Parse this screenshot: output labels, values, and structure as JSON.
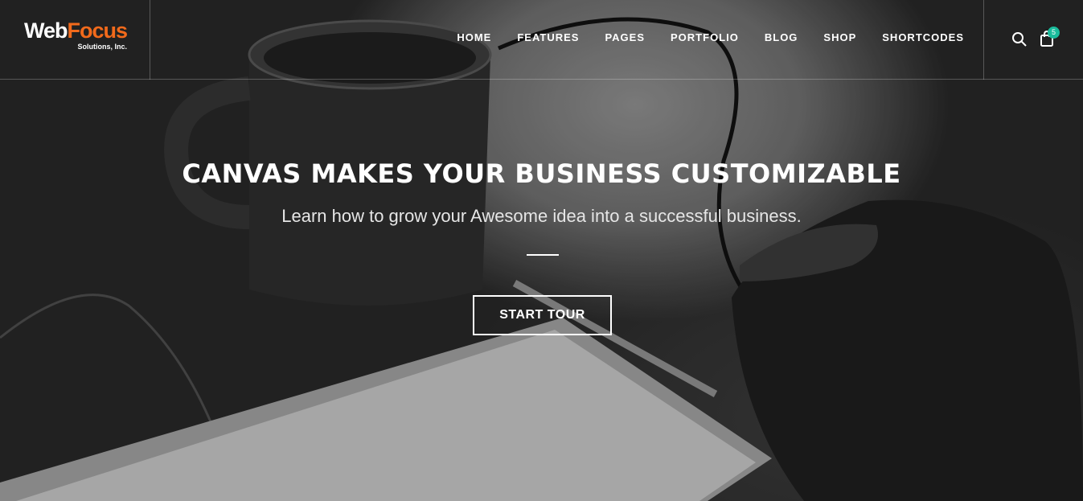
{
  "logo": {
    "word1": "Web",
    "word2": "Focus",
    "tagline": "Solutions, Inc."
  },
  "nav": [
    {
      "label": "HOME"
    },
    {
      "label": "FEATURES"
    },
    {
      "label": "PAGES"
    },
    {
      "label": "PORTFOLIO"
    },
    {
      "label": "BLOG"
    },
    {
      "label": "SHOP"
    },
    {
      "label": "SHORTCODES"
    }
  ],
  "header_icons": {
    "search": "search-icon",
    "cart": "shopping-bag-icon",
    "cart_count": "5"
  },
  "hero": {
    "title": "CANVAS MAKES YOUR BUSINESS CUSTOMIZABLE",
    "subtitle": "Learn how to grow your Awesome idea into a successful business.",
    "cta_label": "START TOUR"
  },
  "colors": {
    "brand_orange": "#f26a1b",
    "badge_green": "#1abc9c",
    "text": "#ffffff"
  }
}
